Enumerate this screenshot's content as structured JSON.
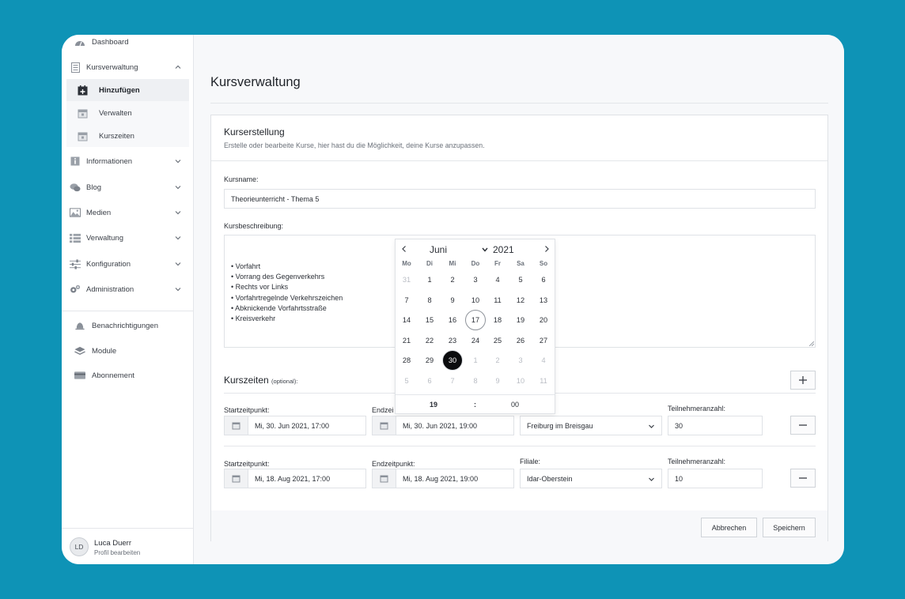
{
  "sidebar": {
    "top_item": "Dashboard",
    "kursverwaltung": "Kursverwaltung",
    "sub": [
      "Hinzufügen",
      "Verwalten",
      "Kurszeiten"
    ],
    "items": [
      "Informationen",
      "Blog",
      "Medien",
      "Verwaltung",
      "Konfiguration",
      "Administration"
    ],
    "extra": [
      "Benachrichtigungen",
      "Module",
      "Abonnement"
    ],
    "user": {
      "initials": "LD",
      "name": "Luca Duerr",
      "edit": "Profil bearbeiten"
    }
  },
  "main": {
    "page_title": "Kursverwaltung",
    "card_title": "Kurserstellung",
    "card_subtitle": "Erstelle oder bearbeite Kurse, hier hast du die Möglichkeit, deine Kurse anzupassen.",
    "kursname_label": "Kursname:",
    "kursname_value": "Theorieunterricht - Thema 5",
    "beschreibung_label": "Kursbeschreibung:",
    "beschreibung_items": [
      "• Vorfahrt",
      "• Vorrang des Gegenverkehrs",
      "• Rechts vor Links",
      "• Vorfahrtregelnde Verkehrszeichen",
      "• Abknickende Vorfahrtsstraße",
      "• Kreisverkehr"
    ],
    "kurszeiten_title": "Kurszeiten",
    "kurszeiten_optional": "(optional):",
    "labels": {
      "start": "Startzeitpunkt:",
      "end": "Endzeitpunkt:",
      "end_partial": "Endzei",
      "filiale": "Filiale:",
      "teilnehmer": "Teilnehmeranzahl:"
    },
    "rows": [
      {
        "start": "Mi, 30. Jun 2021, 17:00",
        "end": "Mi, 30. Jun 2021, 19:00",
        "filiale": "Freiburg im Breisgau",
        "teilnehmer": "30"
      },
      {
        "start": "Mi, 18. Aug 2021, 17:00",
        "end": "Mi, 18. Aug 2021, 19:00",
        "filiale": "Idar-Oberstein",
        "teilnehmer": "10"
      }
    ],
    "buttons": {
      "cancel": "Abbrechen",
      "save": "Speichern"
    }
  },
  "datepicker": {
    "month": "Juni",
    "year": "2021",
    "weekdays": [
      "Mo",
      "Di",
      "Mi",
      "Do",
      "Fr",
      "Sa",
      "So"
    ],
    "weeks": [
      [
        "31",
        "1",
        "2",
        "3",
        "4",
        "5",
        "6"
      ],
      [
        "7",
        "8",
        "9",
        "10",
        "11",
        "12",
        "13"
      ],
      [
        "14",
        "15",
        "16",
        "17",
        "18",
        "19",
        "20"
      ],
      [
        "21",
        "22",
        "23",
        "24",
        "25",
        "26",
        "27"
      ],
      [
        "28",
        "29",
        "30",
        "1",
        "2",
        "3",
        "4"
      ],
      [
        "5",
        "6",
        "7",
        "8",
        "9",
        "10",
        "11"
      ]
    ],
    "today": "17",
    "selected": "30",
    "hour": "19",
    "separator": ":",
    "minute": "00"
  },
  "colors": {
    "background": "#0e93b6",
    "selected_day": "#0b0c0e"
  }
}
